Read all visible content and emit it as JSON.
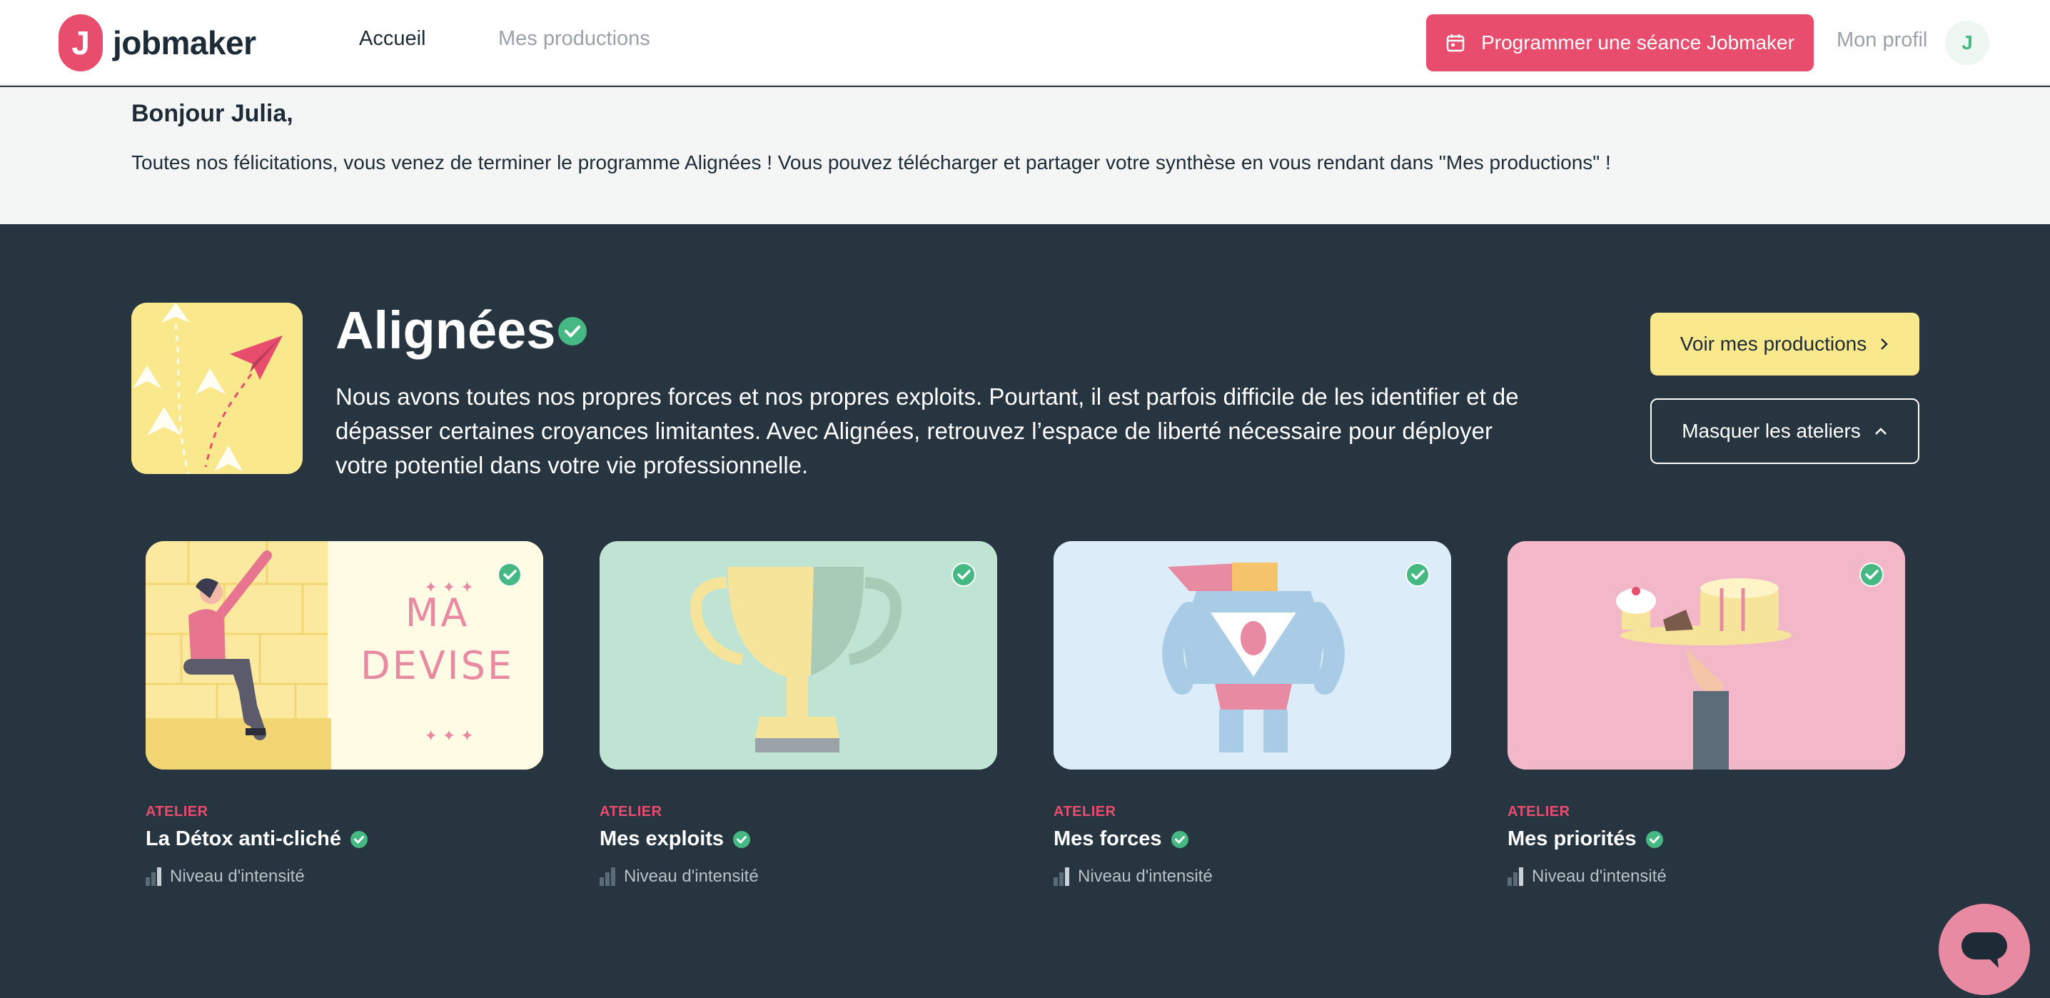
{
  "header": {
    "logo_text": "jobmaker",
    "logo_letter": "J",
    "nav_home": "Accueil",
    "nav_productions": "Mes productions",
    "schedule_button": "Programmer une séance Jobmaker",
    "profile_label": "Mon profil",
    "avatar_initial": "J"
  },
  "greeting": {
    "title": "Bonjour Julia,",
    "message": "Toutes nos félicitations, vous venez de terminer le programme Alignées ! Vous pouvez télécharger et partager votre synthèse en vous rendant dans \"Mes productions\" !"
  },
  "program": {
    "title": "Alignées",
    "description": "Nous avons toutes nos propres forces et nos propres exploits. Pourtant, il est parfois difficile de les identifier et de dépasser certaines croyances limitantes. Avec Alignées, retrouvez l’espace de liberté nécessaire pour déployer votre potentiel dans votre vie professionnelle.",
    "btn_view": "Voir mes productions",
    "btn_hide": "Masquer les ateliers"
  },
  "workshops": [
    {
      "kicker": "ATELIER",
      "title": "La Détox anti-cliché",
      "meta": "Niveau d'intensité",
      "bg": "#f9e88c",
      "image_text_1": "MA",
      "image_text_2": "DEVISE",
      "illustration": "woman-sitting-sign"
    },
    {
      "kicker": "ATELIER",
      "title": "Mes exploits",
      "meta": "Niveau d'intensité",
      "bg": "#bfe4d4",
      "illustration": "trophy"
    },
    {
      "kicker": "ATELIER",
      "title": "Mes forces",
      "meta": "Niveau d'intensité",
      "bg": "#dcecf8",
      "illustration": "superhero"
    },
    {
      "kicker": "ATELIER",
      "title": "Mes priorités",
      "meta": "Niveau d'intensité",
      "bg": "#f2b8c8",
      "illustration": "cake-tray"
    }
  ],
  "colors": {
    "brand_pink": "#e84d6e",
    "check_green": "#45b883",
    "yellow": "#f9e88c",
    "dark_bg": "#263540"
  }
}
